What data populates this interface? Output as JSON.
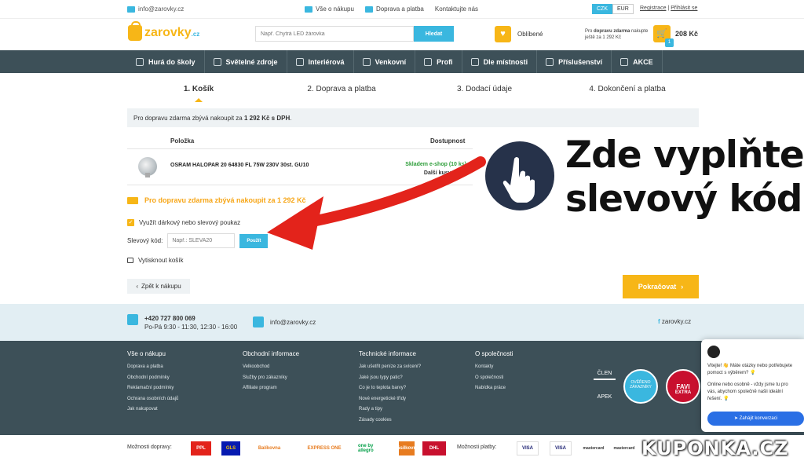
{
  "topbar": {
    "email": "info@zarovky.cz",
    "links": [
      "Vše o nákupu",
      "Doprava a platba",
      "Kontaktujte nás"
    ],
    "currency": [
      "CZK",
      "EUR"
    ],
    "register": "Registrace",
    "separator": "|",
    "login": "Přihlásit se"
  },
  "header": {
    "logo": "zarovky",
    "logo_tld": ".cz",
    "search_placeholder": "Např. Chytrá LED žárovka",
    "search_button": "Hledat",
    "favorites": "Oblíbené",
    "shipping_prefix": "Pro",
    "shipping_bold": "dopravu zdarma",
    "shipping_suffix": "nakupte ještě za 1 292 Kč",
    "cart_total": "208 Kč",
    "cart_count": "1"
  },
  "nav": [
    "Hurá do školy",
    "Světelné zdroje",
    "Interiérová",
    "Venkovní",
    "Profi",
    "Dle místnosti",
    "Příslušenství",
    "AKCE"
  ],
  "steps": [
    "1. Košík",
    "2. Doprava a platba",
    "3. Dodací údaje",
    "4. Dokončení a platba"
  ],
  "info": {
    "prefix": "Pro dopravu zdarma zbývá nakoupit za",
    "amount": "1 292 Kč s DPH",
    "suffix": "."
  },
  "table": {
    "col_item": "Položka",
    "col_stock": "Dostupnost",
    "product": "OSRAM HALOPAR 20 64830 FL 75W 230V 30st. GU10",
    "stock_line1": "Skladem e-shop (10 ks)",
    "stock_line2": "Další kusy 7. 10."
  },
  "free_shipping": "Pro dopravu zdarma zbývá nakoupit za 1 292 Kč",
  "voucher_label": "Využít dárkový nebo slevový poukaz",
  "code": {
    "label": "Slevový kód:",
    "placeholder": "Např.: SLEVA20",
    "button": "Použít"
  },
  "print": "Vytisknout košík",
  "back": "Zpět k nákupu",
  "continue": "Pokračovat",
  "overlay": {
    "line1": "Zde vyplňte",
    "line2": "slevový kód"
  },
  "contact": {
    "phone": "+420 727 800 069",
    "hours": "Po-Pá 9:30 - 11:30, 12:30 - 16:00",
    "email": "info@zarovky.cz",
    "facebook": "zarovky.cz"
  },
  "footer": {
    "cols": [
      {
        "title": "Vše o nákupu",
        "items": [
          "Doprava a platba",
          "Obchodní podmínky",
          "Reklamační podmínky",
          "Ochrana osobních údajů",
          "Jak nakupovat"
        ]
      },
      {
        "title": "Obchodní informace",
        "items": [
          "Velkoobchod",
          "Služby pro zákazníky",
          "Affiliate program"
        ]
      },
      {
        "title": "Technické informace",
        "items": [
          "Jak ušetřit peníze za svícení?",
          "Jaké jsou typy patic?",
          "Co je to teplota barvy?",
          "Nové energetické třídy",
          "Rady a tipy",
          "Zásady cookies"
        ]
      },
      {
        "title": "O společnosti",
        "items": [
          "Kontakty",
          "O společnosti",
          "Nabídka práce"
        ]
      }
    ],
    "member": "ČLEN",
    "apek": "APEK",
    "verified_line1": "OVĚŘENO",
    "verified_line2": "ZÁKAZNÍKY",
    "favi": "FAVI",
    "favi_extra": "EXTRA"
  },
  "chat": {
    "greeting": "Vitejte! 👋 Máte otázky nebo potřebujete pomoct s výběrem? 💡",
    "info": "Online nebo osobně - vždy jsme tu pro vás, abychom společně našli ideální řešení. 💡",
    "button": "Zahájit konverzaci"
  },
  "strip": {
    "shipping_label": "Možnosti dopravy:",
    "carriers": [
      "PPL",
      "GLS",
      "Balíkovna",
      "EXPRESS ONE",
      "one by allegro",
      "Zásilkovna",
      "DHL"
    ],
    "payment_label": "Možnosti platby:",
    "payments": [
      "VISA",
      "VISA",
      "mastercard",
      "mastercard"
    ]
  },
  "watermark": "KUPONKA.CZ"
}
